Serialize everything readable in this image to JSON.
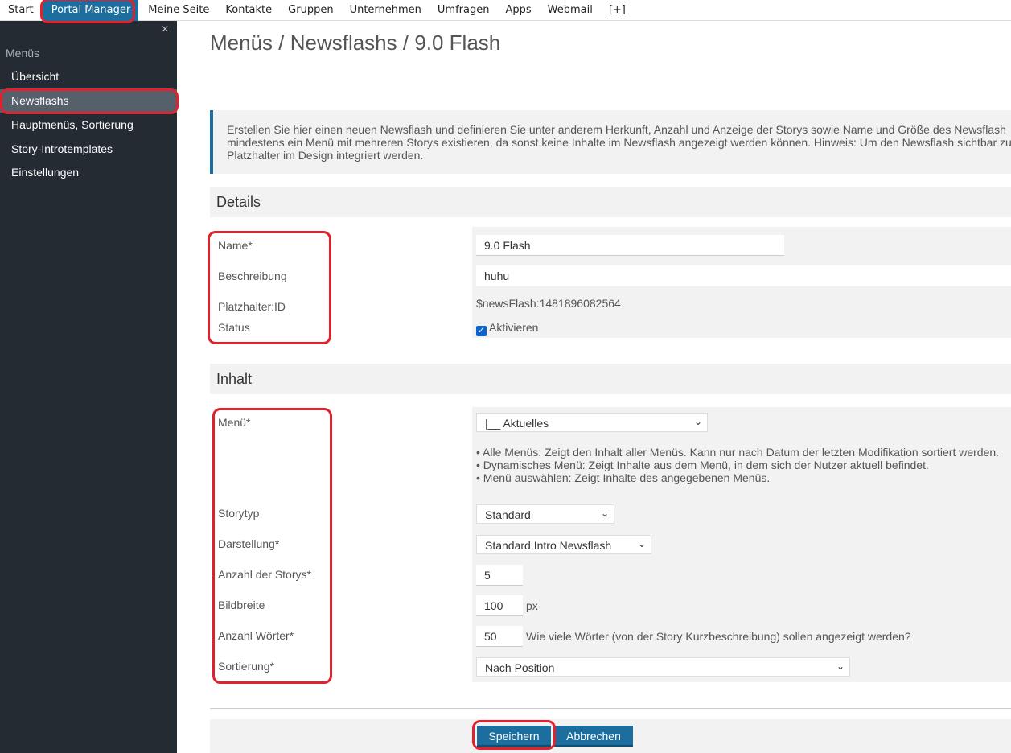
{
  "topnav": {
    "items": [
      "Start",
      "Portal Manager",
      "Meine Seite",
      "Kontakte",
      "Gruppen",
      "Unternehmen",
      "Umfragen",
      "Apps",
      "Webmail",
      "[+]"
    ]
  },
  "sidebar": {
    "close_icon": "×",
    "heading": "Menüs",
    "items": [
      "Übersicht",
      "Newsflashs",
      "Hauptmenüs, Sortierung",
      "Story-Introtemplates",
      "Einstellungen"
    ]
  },
  "page": {
    "title": "Menüs / Newsflashs / 9.0 Flash",
    "info_lines": [
      "Erstellen Sie hier einen neuen Newsflash und definieren Sie unter anderem Herkunft, Anzahl und Anzeige der Storys sowie Name und Größe des Newsflash",
      "mindestens ein Menü mit mehreren Storys existieren, da sonst keine Inhalte im Newsflash angezeigt werden können. Hinweis: Um den Newsflash sichtbar zu",
      "Platzhalter im Design integriert werden."
    ]
  },
  "details": {
    "heading": "Details",
    "name_label": "Name*",
    "name_value": "9.0 Flash",
    "description_label": "Beschreibung",
    "description_value": "huhu",
    "placeholder_label": "Platzhalter:ID",
    "placeholder_value": "$newsFlash:1481896082564",
    "status_label": "Status",
    "status_checkbox_label": "Aktivieren",
    "status_checked": true
  },
  "content": {
    "heading": "Inhalt",
    "menu_label": "Menü*",
    "menu_value": "|__ Aktuelles",
    "menu_hints": [
      "Alle Menüs: Zeigt den Inhalt aller Menüs. Kann nur nach Datum der letzten Modifikation sortiert werden.",
      "Dynamisches Menü: Zeigt Inhalte aus dem Menü, in dem sich der Nutzer aktuell befindet.",
      "Menü auswählen: Zeigt Inhalte des angegebenen Menüs."
    ],
    "storytype_label": "Storytyp",
    "storytype_value": "Standard",
    "display_label": "Darstellung*",
    "display_value": "Standard Intro Newsflash",
    "count_label": "Anzahl der Storys*",
    "count_value": "5",
    "imagewidth_label": "Bildbreite",
    "imagewidth_value": "100",
    "imagewidth_unit": "px",
    "words_label": "Anzahl Wörter*",
    "words_value": "50",
    "words_hint": "Wie viele Wörter (von der Story Kurzbeschreibung) sollen angezeigt werden?",
    "sort_label": "Sortierung*",
    "sort_value": "Nach Position"
  },
  "footer": {
    "save_label": "Speichern",
    "cancel_label": "Abbrechen"
  },
  "colors": {
    "accent": "#1b6e9e",
    "sidebar_bg": "#252b33",
    "highlight_ring": "#e0212e"
  }
}
